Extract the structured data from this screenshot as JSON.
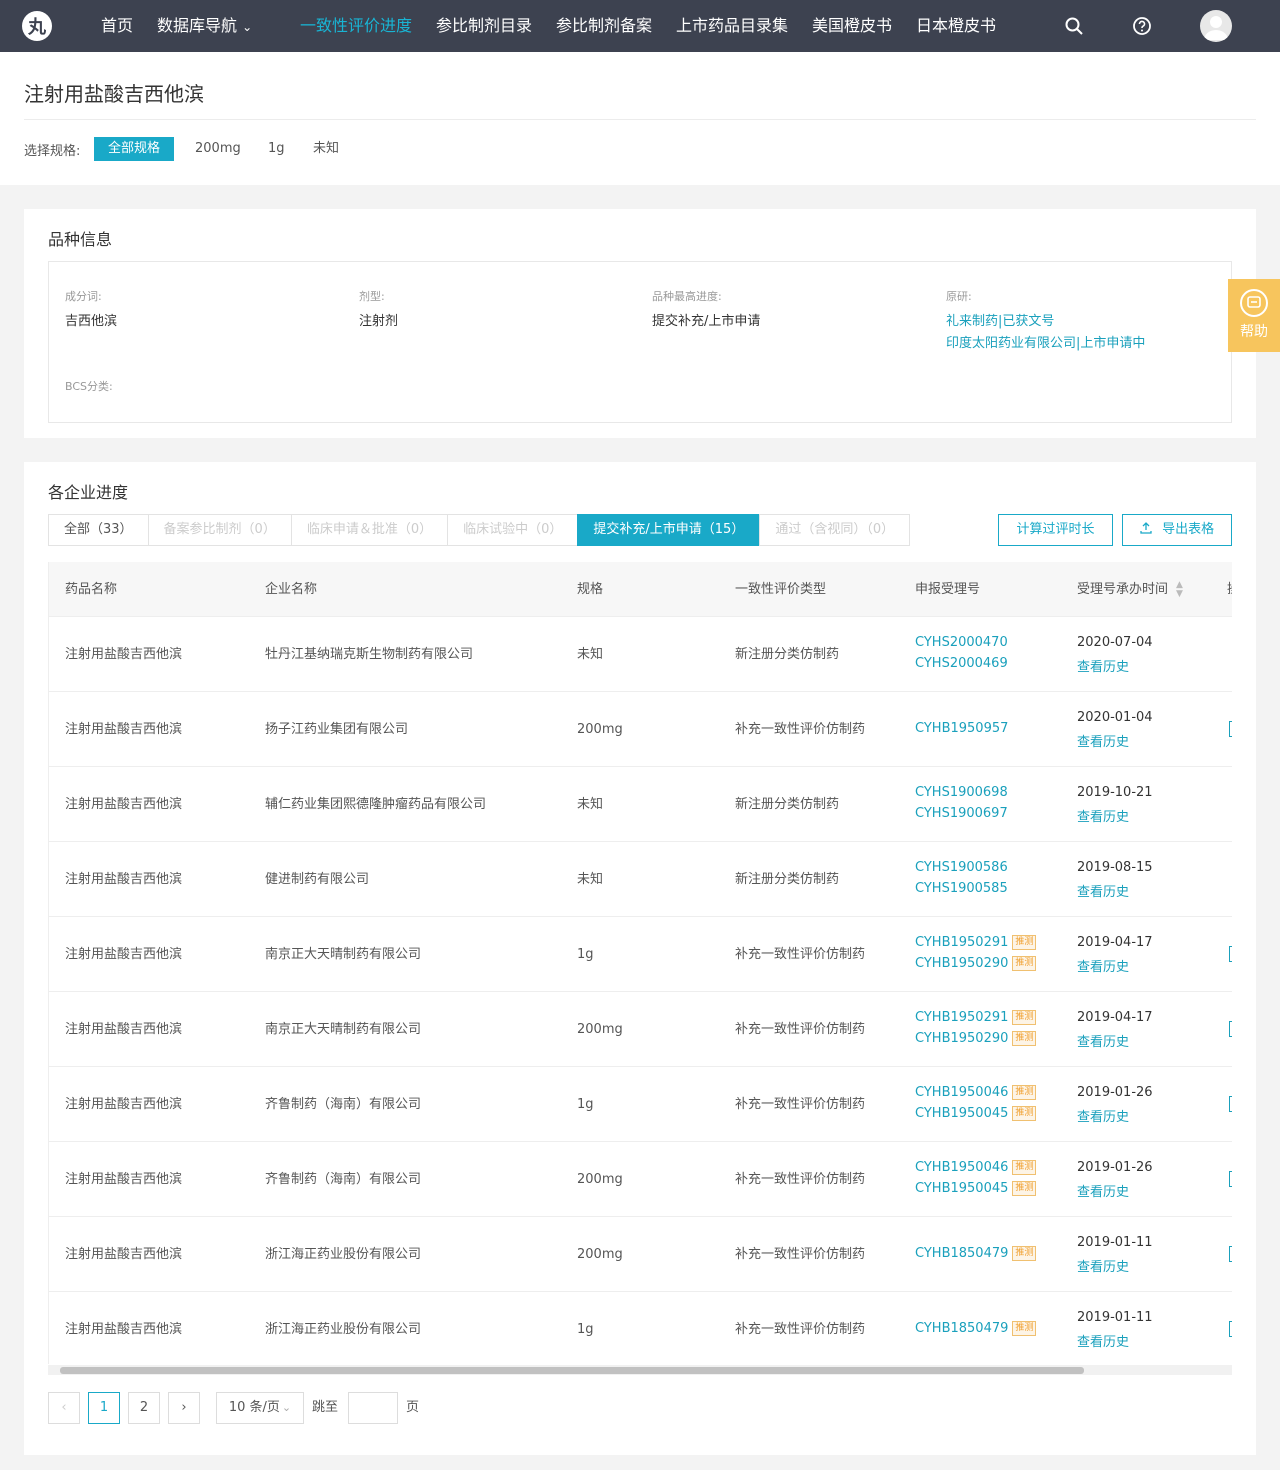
{
  "nav": {
    "logo_text": "丸",
    "items": [
      {
        "label": "首页"
      },
      {
        "label": "数据库导航"
      },
      {
        "label": "一致性评价进度"
      },
      {
        "label": "参比制剂目录"
      },
      {
        "label": "参比制剂备案"
      },
      {
        "label": "上市药品目录集"
      },
      {
        "label": "美国橙皮书"
      },
      {
        "label": "日本橙皮书"
      }
    ],
    "dropdown_glyph": "⌄",
    "active_color": "#19b4d3"
  },
  "header": {
    "title": "注射用盐酸吉西他滨",
    "spec_label": "选择规格:",
    "specs": [
      "全部规格",
      "200mg",
      "1g",
      "未知"
    ]
  },
  "variety": {
    "title": "品种信息",
    "ingredient_label": "成分词:",
    "ingredient": "吉西他滨",
    "form_label": "剂型:",
    "form": "注射剂",
    "progress_label": "品种最高进度:",
    "progress": "提交补充/上市申请",
    "original_label": "原研:",
    "originals": [
      "礼来制药|已获文号",
      "印度太阳药业有限公司|上市申请中"
    ],
    "bcs_label": "BCS分类:"
  },
  "help": {
    "label": "帮助"
  },
  "progress": {
    "title": "各企业进度",
    "tabs": [
      {
        "label": "全部（33）"
      },
      {
        "label": "备案参比制剂（0）"
      },
      {
        "label": "临床申请＆批准（0）"
      },
      {
        "label": "临床试验中（0）"
      },
      {
        "label": "提交补充/上市申请（15）"
      },
      {
        "label": "通过（含视同）（0）"
      }
    ],
    "calc_button": "计算过评时长",
    "export_button": "导出表格",
    "columns": [
      "药品名称",
      "企业名称",
      "规格",
      "一致性评价类型",
      "申报受理号",
      "受理号承办时间",
      "操"
    ],
    "tuice": "推测",
    "history": "查看历史",
    "rows": [
      {
        "name": "注射用盐酸吉西他滨",
        "company": "牡丹江基纳瑞克斯生物制药有限公司",
        "spec": "未知",
        "type": "新注册分类仿制药",
        "codes": [
          "CYHS2000470",
          "CYHS2000469"
        ],
        "tuice": false,
        "date": "2020-07-04",
        "edge": false
      },
      {
        "name": "注射用盐酸吉西他滨",
        "company": "扬子江药业集团有限公司",
        "spec": "200mg",
        "type": "补充一致性评价仿制药",
        "codes": [
          "CYHB1950957"
        ],
        "tuice": false,
        "date": "2020-01-04",
        "edge": true
      },
      {
        "name": "注射用盐酸吉西他滨",
        "company": "辅仁药业集团熙德隆肿瘤药品有限公司",
        "spec": "未知",
        "type": "新注册分类仿制药",
        "codes": [
          "CYHS1900698",
          "CYHS1900697"
        ],
        "tuice": false,
        "date": "2019-10-21",
        "edge": false
      },
      {
        "name": "注射用盐酸吉西他滨",
        "company": "健进制药有限公司",
        "spec": "未知",
        "type": "新注册分类仿制药",
        "codes": [
          "CYHS1900586",
          "CYHS1900585"
        ],
        "tuice": false,
        "date": "2019-08-15",
        "edge": false
      },
      {
        "name": "注射用盐酸吉西他滨",
        "company": "南京正大天晴制药有限公司",
        "spec": "1g",
        "type": "补充一致性评价仿制药",
        "codes": [
          "CYHB1950291",
          "CYHB1950290"
        ],
        "tuice": true,
        "date": "2019-04-17",
        "edge": true
      },
      {
        "name": "注射用盐酸吉西他滨",
        "company": "南京正大天晴制药有限公司",
        "spec": "200mg",
        "type": "补充一致性评价仿制药",
        "codes": [
          "CYHB1950291",
          "CYHB1950290"
        ],
        "tuice": true,
        "date": "2019-04-17",
        "edge": true
      },
      {
        "name": "注射用盐酸吉西他滨",
        "company": "齐鲁制药（海南）有限公司",
        "spec": "1g",
        "type": "补充一致性评价仿制药",
        "codes": [
          "CYHB1950046",
          "CYHB1950045"
        ],
        "tuice": true,
        "date": "2019-01-26",
        "edge": true
      },
      {
        "name": "注射用盐酸吉西他滨",
        "company": "齐鲁制药（海南）有限公司",
        "spec": "200mg",
        "type": "补充一致性评价仿制药",
        "codes": [
          "CYHB1950046",
          "CYHB1950045"
        ],
        "tuice": true,
        "date": "2019-01-26",
        "edge": true
      },
      {
        "name": "注射用盐酸吉西他滨",
        "company": "浙江海正药业股份有限公司",
        "spec": "200mg",
        "type": "补充一致性评价仿制药",
        "codes": [
          "CYHB1850479"
        ],
        "tuice": true,
        "date": "2019-01-11",
        "edge": true
      },
      {
        "name": "注射用盐酸吉西他滨",
        "company": "浙江海正药业股份有限公司",
        "spec": "1g",
        "type": "补充一致性评价仿制药",
        "codes": [
          "CYHB1850479"
        ],
        "tuice": true,
        "date": "2019-01-11",
        "edge": true
      }
    ]
  },
  "pagination": {
    "prev": "‹",
    "pages": [
      "1",
      "2"
    ],
    "next": "›",
    "page_size": "10 条/页",
    "jump_label": "跳至",
    "page_unit": "页"
  }
}
